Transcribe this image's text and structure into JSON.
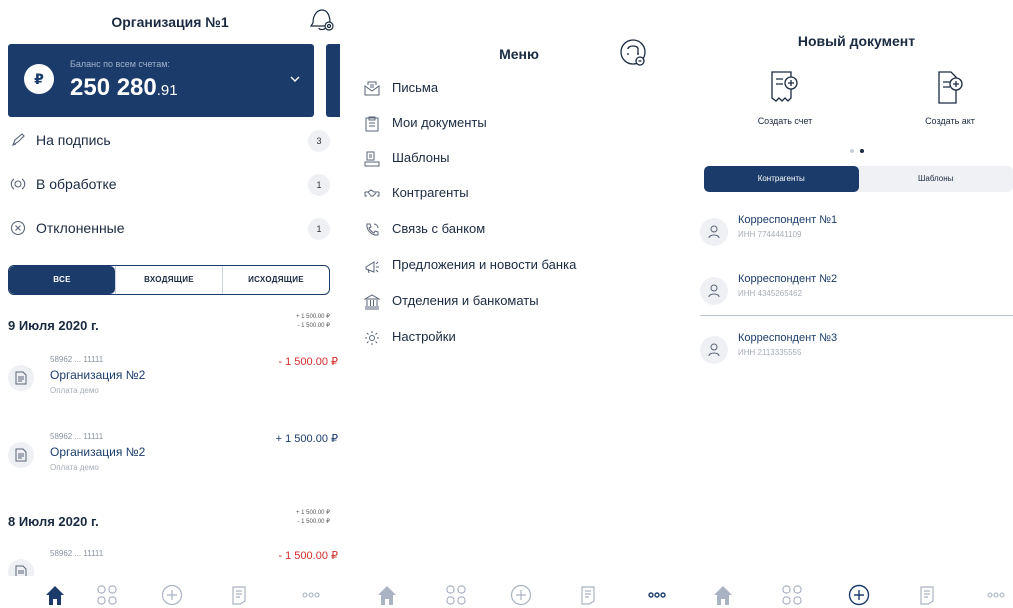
{
  "screen1": {
    "org_title": "Организация №1",
    "balance": {
      "label": "Баланс по всем счетам:",
      "currency_badge": "₽",
      "amount_main": "250 280",
      "amount_fraction": ".91"
    },
    "statuses": [
      {
        "label": "На подпись",
        "count": "3",
        "icon": "pen-icon"
      },
      {
        "label": "В обработке",
        "count": "1",
        "icon": "processing-icon"
      },
      {
        "label": "Отклоненные",
        "count": "1",
        "icon": "x-circle-icon"
      }
    ],
    "filter_tabs": [
      {
        "label": "ВСЕ",
        "active": true
      },
      {
        "label": "ВХОДЯЩИЕ",
        "active": false
      },
      {
        "label": "ИСХОДЯЩИЕ",
        "active": false
      }
    ],
    "groups": [
      {
        "date": "9 Июля 2020 г.",
        "total_in": "+ 1 500.00 ₽",
        "total_out": "- 1 500.00 ₽",
        "transactions": [
          {
            "number": "58962 ... 11111",
            "name": "Организация №2",
            "purpose": "Оплата демо",
            "amount": "- 1 500.00 ₽",
            "direction": "out"
          },
          {
            "number": "58962 ... 11111",
            "name": "Организация №2",
            "purpose": "Оплата демо",
            "amount": "+ 1 500.00 ₽",
            "direction": "in"
          }
        ]
      },
      {
        "date": "8 Июля 2020 г.",
        "total_in": "+ 1 500.00 ₽",
        "total_out": "- 1 500.00 ₽",
        "transactions": [
          {
            "number": "58962 ... 11111",
            "name": "",
            "purpose": "",
            "amount": "- 1 500.00 ₽",
            "direction": "out"
          }
        ]
      }
    ]
  },
  "screen2": {
    "title": "Меню",
    "items": [
      {
        "label": "Письма",
        "icon": "letters-icon"
      },
      {
        "label": "Мои документы",
        "icon": "documents-icon"
      },
      {
        "label": "Шаблоны",
        "icon": "templates-icon"
      },
      {
        "label": "Контрагенты",
        "icon": "handshake-icon"
      },
      {
        "label": "Связь с банком",
        "icon": "phone-icon"
      },
      {
        "label": "Предложения и новости банка",
        "icon": "megaphone-icon"
      },
      {
        "label": "Отделения и банкоматы",
        "icon": "bank-icon"
      },
      {
        "label": "Настройки",
        "icon": "settings-icon"
      }
    ]
  },
  "screen3": {
    "title": "Новый документ",
    "actions": [
      {
        "label": "Создать счет",
        "icon": "create-invoice-icon"
      },
      {
        "label": "Создать акт",
        "icon": "create-act-icon"
      }
    ],
    "tabs": [
      {
        "label": "Контрагенты",
        "active": true
      },
      {
        "label": "Шаблоны",
        "active": false
      }
    ],
    "counterparties": [
      {
        "name": "Корреспондент №1",
        "inn": "ИНН 7744441109"
      },
      {
        "name": "Корреспондент №2",
        "inn": "ИНН 4345265462"
      },
      {
        "name": "Корреспондент №3",
        "inn": "ИНН 2113335555"
      }
    ]
  },
  "tabbar": {
    "items": [
      "home-icon",
      "apps-icon",
      "plus-icon",
      "documents-icon",
      "more-icon"
    ],
    "screen1_active": "home-icon",
    "screen2_active": "more-icon",
    "screen3_active": "plus-icon"
  },
  "colors": {
    "primary": "#1b3c6b",
    "negative": "#d72c2c",
    "inactive": "#a9b3c2",
    "badge_bg": "#eef0f4"
  }
}
